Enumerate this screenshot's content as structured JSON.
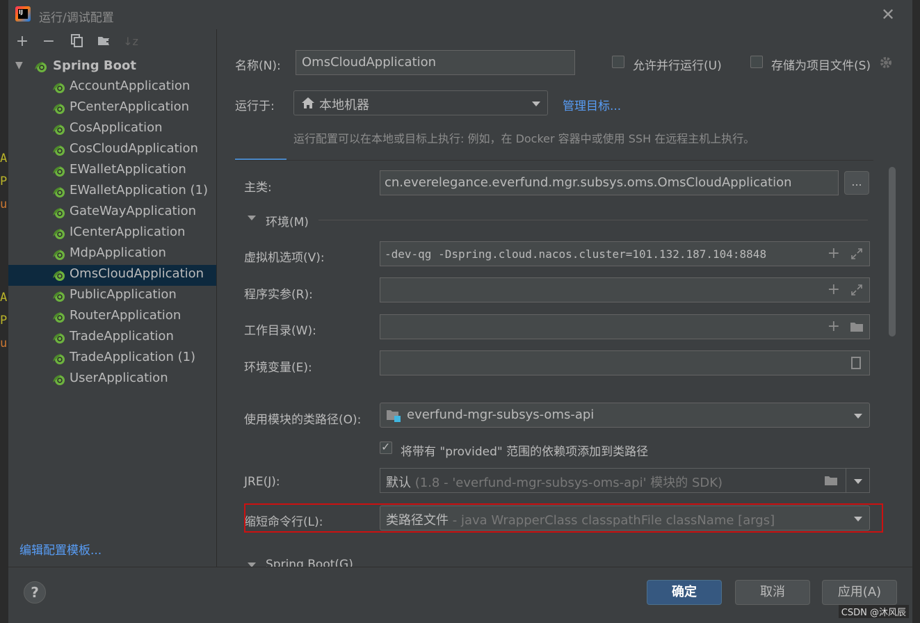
{
  "window": {
    "title": "运行/调试配置"
  },
  "sidebar": {
    "root_label": "Spring Boot",
    "items": [
      {
        "label": "AccountApplication"
      },
      {
        "label": "PCenterApplication"
      },
      {
        "label": "CosApplication"
      },
      {
        "label": "CosCloudApplication"
      },
      {
        "label": "EWalletApplication"
      },
      {
        "label": "EWalletApplication (1)"
      },
      {
        "label": "GateWayApplication"
      },
      {
        "label": "ICenterApplication"
      },
      {
        "label": "MdpApplication"
      },
      {
        "label": "OmsCloudApplication",
        "selected": true
      },
      {
        "label": "PublicApplication"
      },
      {
        "label": "RouterApplication"
      },
      {
        "label": "TradeApplication"
      },
      {
        "label": "TradeApplication (1)"
      },
      {
        "label": "UserApplication"
      }
    ],
    "edit_templates_link": "编辑配置模板..."
  },
  "form": {
    "name_label": "名称(N):",
    "name_value": "OmsCloudApplication",
    "allow_parallel_label": "允许并行运行(U)",
    "store_as_project_label": "存储为项目文件(S)",
    "run_on_label": "运行于:",
    "run_on_value": "本地机器",
    "manage_targets_link": "管理目标...",
    "run_on_hint": "运行配置可以在本地或目标上执行: 例如，在 Docker 容器中或使用 SSH 在远程主机上执行。",
    "main_class_label": "主类:",
    "main_class_value": "cn.everelegance.everfund.mgr.subsys.oms.OmsCloudApplication",
    "browse_button": "...",
    "env_section": "环境(M)",
    "vm_options_label": "虚拟机选项(V):",
    "vm_options_value": "-dev-qg -Dspring.cloud.nacos.cluster=101.132.187.104:8848",
    "program_args_label": "程序实参(R):",
    "program_args_value": "",
    "working_dir_label": "工作目录(W):",
    "working_dir_value": "",
    "env_vars_label": "环境变量(E):",
    "env_vars_value": "",
    "classpath_label": "使用模块的类路径(O):",
    "classpath_value": "everfund-mgr-subsys-oms-api",
    "provided_checkbox_label": "将带有 \"provided\" 范围的依赖项添加到类路径",
    "jre_label": "JRE(J):",
    "jre_value_main": "默认",
    "jre_value_detail": "(1.8 - 'everfund-mgr-subsys-oms-api' 模块的 SDK)",
    "shorten_label": "缩短命令行(L):",
    "shorten_value_main": "类路径文件",
    "shorten_value_detail": "- java WrapperClass classpathFile className [args]",
    "spring_boot_section": "Spring Boot(G)"
  },
  "footer": {
    "help": "?",
    "ok": "确定",
    "cancel": "取消",
    "apply": "应用(A)"
  },
  "watermark": "CSDN @沐风辰",
  "colors": {
    "accent": "#589df6",
    "primary_button": "#365880",
    "highlight": "#cc1111",
    "selection": "#0d293e"
  }
}
